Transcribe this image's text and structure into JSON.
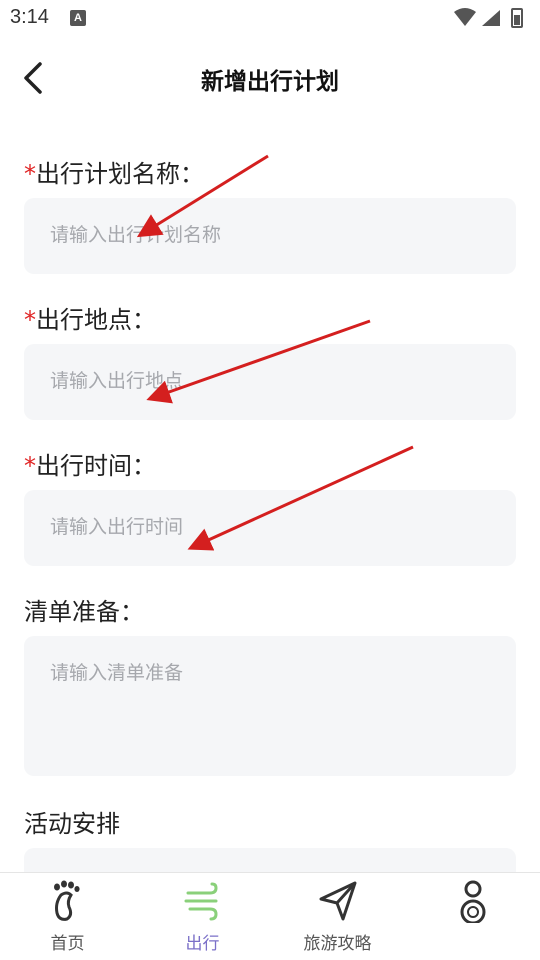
{
  "status": {
    "time": "3:14",
    "notif_letter": "A"
  },
  "header": {
    "title": "新增出行计划"
  },
  "form": {
    "required_mark": "*",
    "fields": [
      {
        "label": "出行计划名称：",
        "required": true,
        "placeholder": "请输入出行计划名称"
      },
      {
        "label": "出行地点：",
        "required": true,
        "placeholder": "请输入出行地点"
      },
      {
        "label": "出行时间：",
        "required": true,
        "placeholder": "请输入出行时间"
      },
      {
        "label": "清单准备：",
        "required": false,
        "placeholder": "请输入清单准备"
      },
      {
        "label": "活动安排",
        "required": false,
        "placeholder": ""
      }
    ]
  },
  "tabbar": {
    "active_color": "#7b70c8",
    "tabs": [
      {
        "label": "首页",
        "icon": "footprint-icon",
        "active": false
      },
      {
        "label": "出行",
        "icon": "wind-icon",
        "active": true
      },
      {
        "label": "旅游攻略",
        "icon": "paper-plane-icon",
        "active": false
      },
      {
        "label": "",
        "icon": "user-profile-icon",
        "active": false
      }
    ]
  },
  "annotation_color": "#d41f1f"
}
